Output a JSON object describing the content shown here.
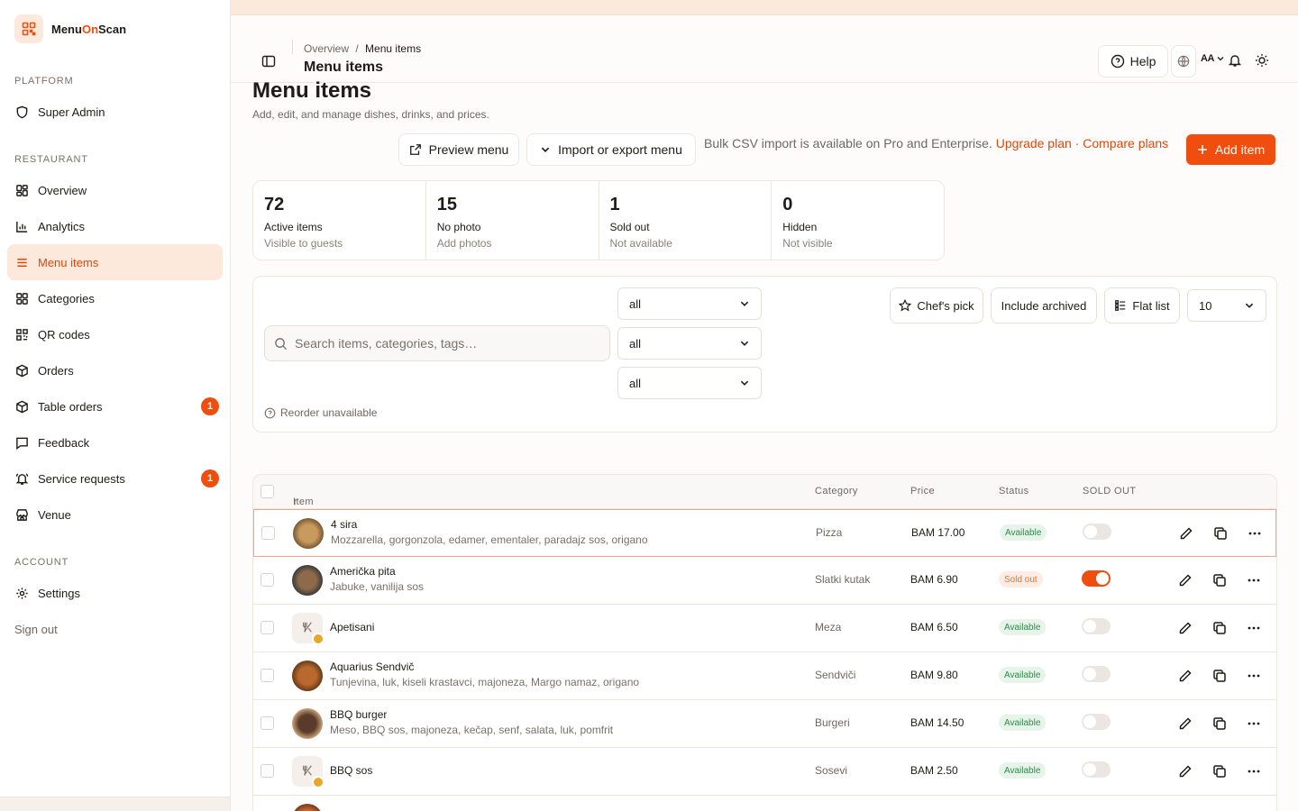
{
  "brand": {
    "name_a": "Menu",
    "name_b": "On",
    "name_c": "Scan"
  },
  "sidebar": {
    "platform_label": "PLATFORM",
    "platform_items": [
      {
        "label": "Super Admin"
      }
    ],
    "restaurant_label": "RESTAURANT",
    "restaurant_items": [
      {
        "label": "Overview"
      },
      {
        "label": "Analytics"
      },
      {
        "label": "Menu items",
        "active": true
      },
      {
        "label": "Categories"
      },
      {
        "label": "QR codes"
      },
      {
        "label": "Orders"
      },
      {
        "label": "Table orders",
        "badge": "1"
      },
      {
        "label": "Feedback"
      },
      {
        "label": "Service requests",
        "badge": "1"
      },
      {
        "label": "Venue"
      }
    ],
    "account_label": "ACCOUNT",
    "account_items": [
      {
        "label": "Settings"
      }
    ],
    "sign_out": "Sign out"
  },
  "header": {
    "breadcrumb_root": "Overview",
    "breadcrumb_sep": "/",
    "breadcrumb_current": "Menu items",
    "title": "Menu items",
    "help_label": "Help",
    "aa_label": "AA"
  },
  "page": {
    "title": "Menu items",
    "subtitle": "Add, edit, and manage dishes, drinks, and prices."
  },
  "actions": {
    "preview_label": "Preview menu",
    "import_label": "Import or export menu",
    "bulk_note": "Bulk CSV import is available on Pro and Enterprise.",
    "upgrade_link": "Upgrade plan",
    "dot": "·",
    "compare_link": "Compare plans",
    "add_label": "Add item"
  },
  "stats": [
    {
      "value": "72",
      "label": "Active items",
      "sub": "Visible to guests"
    },
    {
      "value": "15",
      "label": "No photo",
      "sub": "Add photos"
    },
    {
      "value": "1",
      "label": "Sold out",
      "sub": "Not available"
    },
    {
      "value": "0",
      "label": "Hidden",
      "sub": "Not visible"
    }
  ],
  "filters": {
    "search_placeholder": "Search items, categories, tags…",
    "select1": "all",
    "select2": "all",
    "select3": "all",
    "chefs_pick": "Chef's pick",
    "include_archived": "Include archived",
    "flat_list": "Flat list",
    "page_size": "10",
    "reorder_note": "Reorder unavailable"
  },
  "table": {
    "columns": {
      "item": "Item",
      "sort_arrow": "↑",
      "category": "Category",
      "price": "Price",
      "status": "Status",
      "sold_out": "SOLD OUT"
    },
    "rows": [
      {
        "name": "4 sira",
        "desc": "Mozzarella, gorgonzola, edamer, ementaler, paradajz sos, origano",
        "category": "Pizza",
        "price": "BAM 17.00",
        "status": "Available",
        "sold_out": false,
        "photo": true
      },
      {
        "name": "Američka pita",
        "desc": "Jabuke, vanilija sos",
        "category": "Slatki kutak",
        "price": "BAM 6.90",
        "status": "Sold out",
        "sold_out": true,
        "photo": true
      },
      {
        "name": "Apetisani",
        "desc": "",
        "category": "Meza",
        "price": "BAM 6.50",
        "status": "Available",
        "sold_out": false,
        "photo": false
      },
      {
        "name": "Aquarius Sendvič",
        "desc": "Tunjevina, luk, kiseli krastavci, majoneza, Margo namaz, origano",
        "category": "Sendviči",
        "price": "BAM 9.80",
        "status": "Available",
        "sold_out": false,
        "photo": true
      },
      {
        "name": "BBQ burger",
        "desc": "Meso, BBQ sos, majoneza, kečap, senf, salata, luk, pomfrit",
        "category": "Burgeri",
        "price": "BAM 14.50",
        "status": "Available",
        "sold_out": false,
        "photo": true
      },
      {
        "name": "BBQ sos",
        "desc": "",
        "category": "Sosevi",
        "price": "BAM 2.50",
        "status": "Available",
        "sold_out": false,
        "photo": false
      }
    ]
  },
  "colors": {
    "accent": "#f04e0e",
    "accent_soft": "#fde8dc",
    "available": "#2f8a4a",
    "sold_out": "#e0762e"
  }
}
